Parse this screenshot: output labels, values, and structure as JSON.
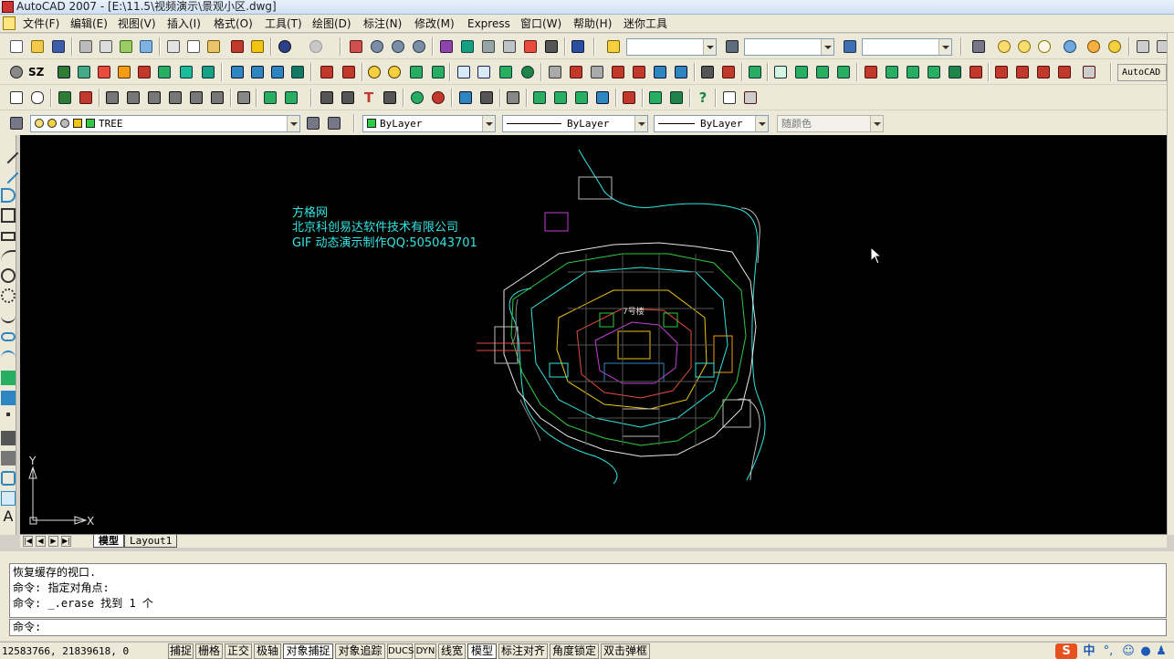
{
  "window": {
    "title": "AutoCAD 2007 - [E:\\11.5\\视频演示\\景观小区.dwg]"
  },
  "menu": [
    "文件(F)",
    "编辑(E)",
    "视图(V)",
    "插入(I)",
    "格式(O)",
    "工具(T)",
    "绘图(D)",
    "标注(N)",
    "修改(M)",
    "Express",
    "窗口(W)",
    "帮助(H)",
    "迷你工具"
  ],
  "toolbar": {
    "autocad_button": "AutoCAD"
  },
  "layers": {
    "current_layer": "TREE",
    "color": "ByLayer",
    "linetype": "ByLayer",
    "lineweight": "ByLayer",
    "plot_style": "随颜色"
  },
  "canvas": {
    "watermark_lines": [
      "方格网",
      "北京科创易达软件技术有限公司",
      "GIF 动态演示制作QQ:505043701"
    ],
    "ucs_x": "X",
    "ucs_y": "Y",
    "plan_label": "7号楼"
  },
  "tabs": [
    {
      "label": "模型",
      "active": true
    },
    {
      "label": "Layout1",
      "active": false
    }
  ],
  "command": {
    "history": [
      "恢复缓存的视口.",
      "命令: 指定对角点:",
      "命令: _.erase 找到 1 个"
    ],
    "prompt": "命令:"
  },
  "status": {
    "coordinates": "12583766, 21839618, 0",
    "buttons": [
      {
        "label": "捕捉",
        "on": false
      },
      {
        "label": "栅格",
        "on": false
      },
      {
        "label": "正交",
        "on": false
      },
      {
        "label": "极轴",
        "on": false
      },
      {
        "label": "对象捕捉",
        "on": true
      },
      {
        "label": "对象追踪",
        "on": false
      },
      {
        "label": "DUCS",
        "on": false
      },
      {
        "label": "DYN",
        "on": false
      },
      {
        "label": "线宽",
        "on": false
      },
      {
        "label": "模型",
        "on": true
      },
      {
        "label": "标注对齐",
        "on": false
      },
      {
        "label": "角度锁定",
        "on": false
      },
      {
        "label": "双击弹框",
        "on": false
      }
    ],
    "ime_label": "中"
  }
}
